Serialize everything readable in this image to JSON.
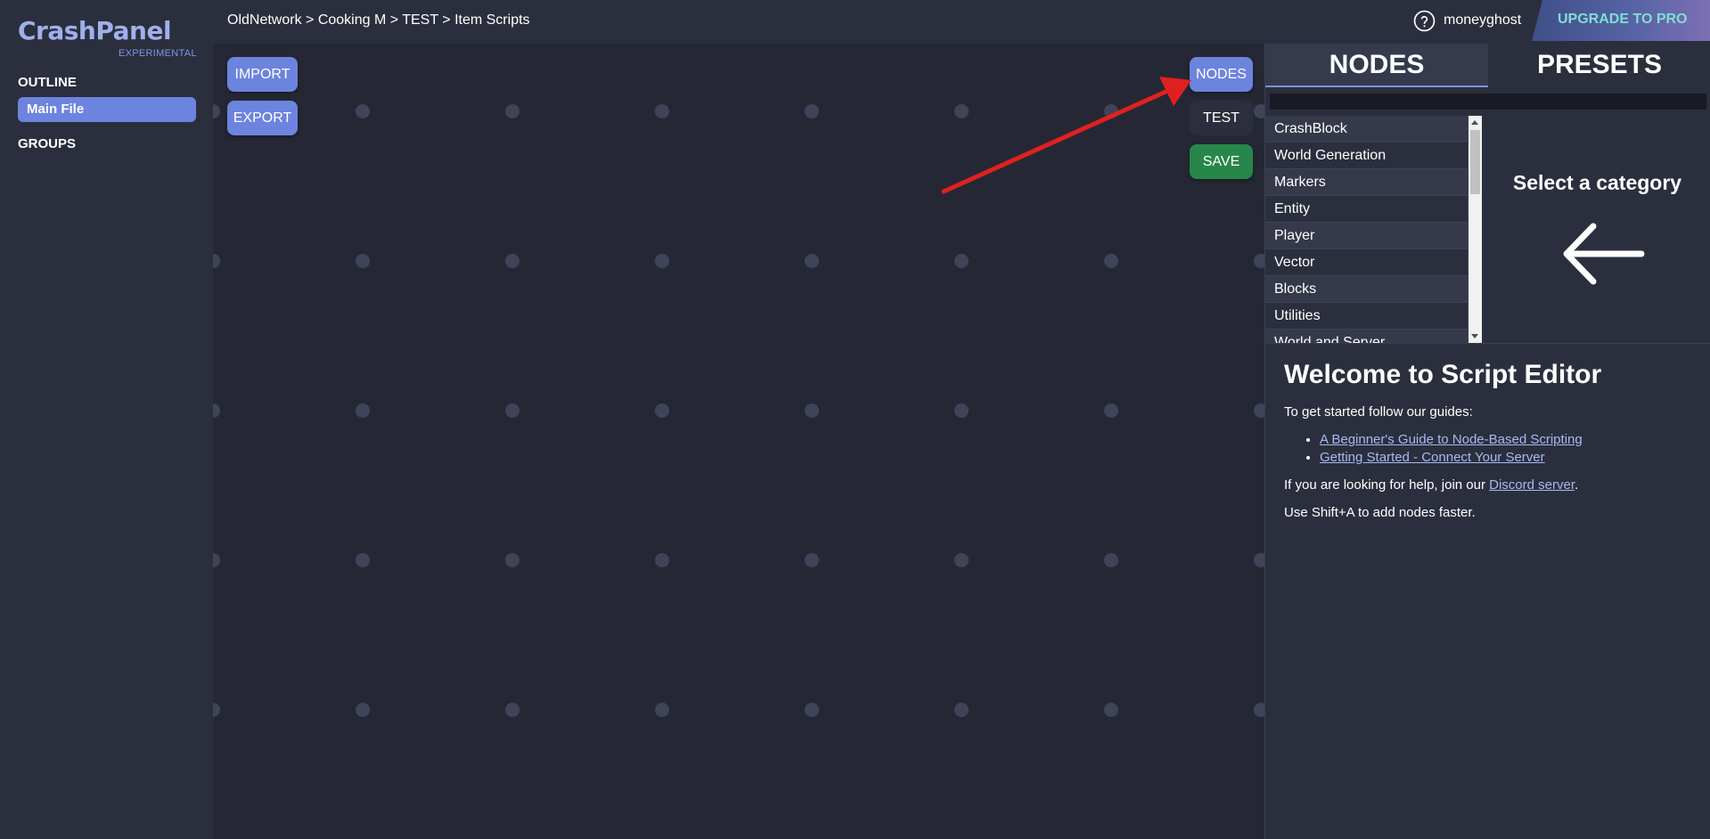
{
  "sidebar": {
    "brand": "CrashPanel",
    "brand_sub": "EXPERIMENTAL",
    "outline_heading": "OUTLINE",
    "main_file": "Main File",
    "groups_heading": "GROUPS"
  },
  "topbar": {
    "breadcrumb": "OldNetwork > Cooking M > TEST > Item Scripts",
    "username": "moneyghost",
    "upgrade_label": "UPGRADE TO PRO"
  },
  "canvas": {
    "import_label": "IMPORT",
    "export_label": "EXPORT",
    "nodes_label": "NODES",
    "test_label": "TEST",
    "save_label": "SAVE",
    "annotation_arrow_color": "#e02020"
  },
  "panel": {
    "tab_nodes": "NODES",
    "tab_presets": "PRESETS",
    "search_value": "",
    "categories": [
      "CrashBlock",
      "World Generation",
      "Markers",
      "Entity",
      "Player",
      "Vector",
      "Blocks",
      "Utilities",
      "World and Server"
    ],
    "select_title": "Select a category",
    "welcome_title": "Welcome to Script Editor",
    "welcome_intro": "To get started follow our guides:",
    "guide_links": [
      "A Beginner's Guide to Node-Based Scripting",
      "Getting Started - Connect Your Server"
    ],
    "help_text_before": "If you are looking for help, join our ",
    "help_link": "Discord server",
    "help_text_after": ".",
    "shortcut_tip": "Use Shift+A to add nodes faster."
  },
  "colors": {
    "accent": "#6d84de",
    "save_green": "#27874a",
    "background": "#2b2f3d",
    "canvas": "#252834"
  },
  "icons": [
    "help-circle-icon",
    "arrow-left-icon"
  ]
}
